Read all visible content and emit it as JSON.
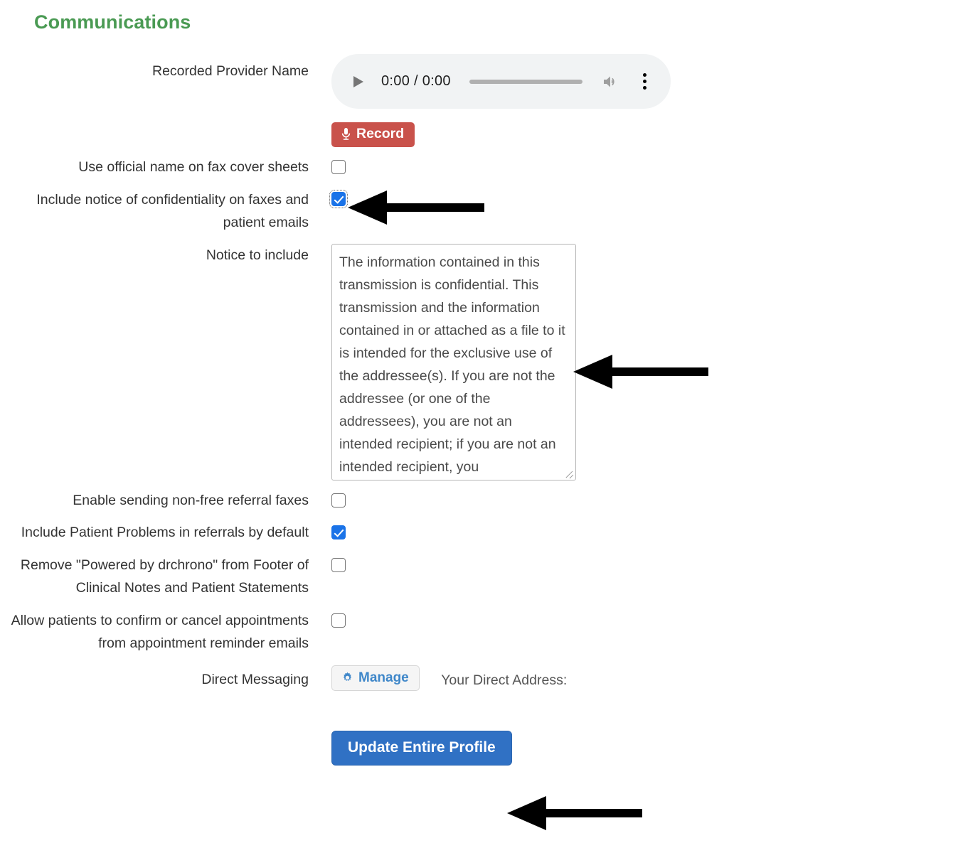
{
  "page": {
    "title": "Communications",
    "title_color": "#4a9a53"
  },
  "audio_player": {
    "current_time": "0:00",
    "duration": "0:00",
    "time_display": "0:00 / 0:00",
    "play_icon": "play-icon",
    "volume_icon": "volume-icon",
    "menu_icon": "more-vertical-icon",
    "progress_percent": 0
  },
  "fields": {
    "recorded_provider_name": {
      "label": "Recorded Provider Name"
    },
    "record_button": {
      "label": "Record",
      "icon": "microphone-icon",
      "color": "#c9524b"
    },
    "use_official_name": {
      "label": "Use official name on fax cover sheets",
      "checked": false
    },
    "include_confidentiality": {
      "label": "Include notice of confidentiality on faxes and patient emails",
      "checked": true,
      "focused": true
    },
    "notice_to_include": {
      "label": "Notice to include",
      "value": "The information contained in this transmission is confidential. This transmission and the information contained in or attached as a file to it is intended for the exclusive use of the addressee(s). If you are not the addressee (or one of the addressees), you are not an intended recipient; if you are not an intended recipient, you",
      "resize_handle": "resize-grip-icon"
    },
    "enable_nonfree_faxes": {
      "label": "Enable sending non-free referral faxes",
      "checked": false
    },
    "include_patient_problems": {
      "label": "Include Patient Problems in referrals by default",
      "checked": true
    },
    "remove_powered_by": {
      "label": "Remove \"Powered by drchrono\" from Footer of Clinical Notes and Patient Statements",
      "checked": false
    },
    "allow_patients_confirm": {
      "label": "Allow patients to confirm or cancel appointments from appointment reminder emails",
      "checked": false
    },
    "direct_messaging": {
      "label": "Direct Messaging",
      "manage_button": "Manage",
      "manage_icon": "gear-icon",
      "direct_address_label": "Your Direct Address:",
      "direct_address_value": ""
    }
  },
  "footer": {
    "update_button": "Update Entire Profile",
    "update_button_color": "#3071c4"
  },
  "annotations": {
    "checkbox_arrow": "left-pointing-arrow",
    "textarea_arrow": "left-pointing-arrow",
    "update_button_arrow": "left-pointing-arrow"
  }
}
